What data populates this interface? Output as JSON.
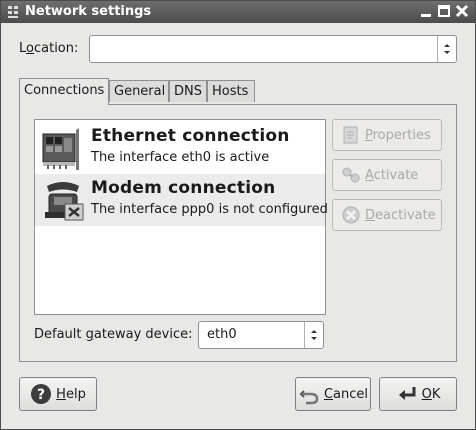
{
  "window": {
    "title": "Network settings"
  },
  "location": {
    "label_pre": "L",
    "label_ul": "o",
    "label_post": "cation:",
    "value": ""
  },
  "tabs": [
    {
      "label": "Connections",
      "active": true
    },
    {
      "label": "General",
      "active": false
    },
    {
      "label": "DNS",
      "active": false
    },
    {
      "label": "Hosts",
      "active": false
    }
  ],
  "connections": [
    {
      "name": "Ethernet connection",
      "description": "The interface eth0 is active",
      "icon": "ethernet-card-icon",
      "selected": false
    },
    {
      "name": "Modem connection",
      "description": "The interface ppp0 is not configured",
      "icon": "modem-icon",
      "selected": true
    }
  ],
  "side_buttons": {
    "properties": {
      "pre": "",
      "ul": "P",
      "post": "roperties",
      "icon": "properties-icon",
      "enabled": false
    },
    "activate": {
      "pre": "",
      "ul": "A",
      "post": "ctivate",
      "icon": "activate-icon",
      "enabled": false
    },
    "deactivate": {
      "pre": "",
      "ul": "D",
      "post": "eactivate",
      "icon": "deactivate-icon",
      "enabled": false
    }
  },
  "gateway": {
    "label_pre": "Default ",
    "label_ul": "g",
    "label_post": "ateway device:",
    "value": "eth0"
  },
  "footer": {
    "help": {
      "pre": "",
      "ul": "H",
      "post": "elp",
      "icon": "help-icon"
    },
    "cancel": {
      "pre": "",
      "ul": "C",
      "post": "ancel",
      "icon": "cancel-icon"
    },
    "ok": {
      "pre": "",
      "ul": "O",
      "post": "K",
      "icon": "ok-icon"
    }
  },
  "colors": {
    "titlebar": "#555555",
    "window_bg": "#e8e8e6",
    "disabled_text": "#a9a9a7"
  }
}
